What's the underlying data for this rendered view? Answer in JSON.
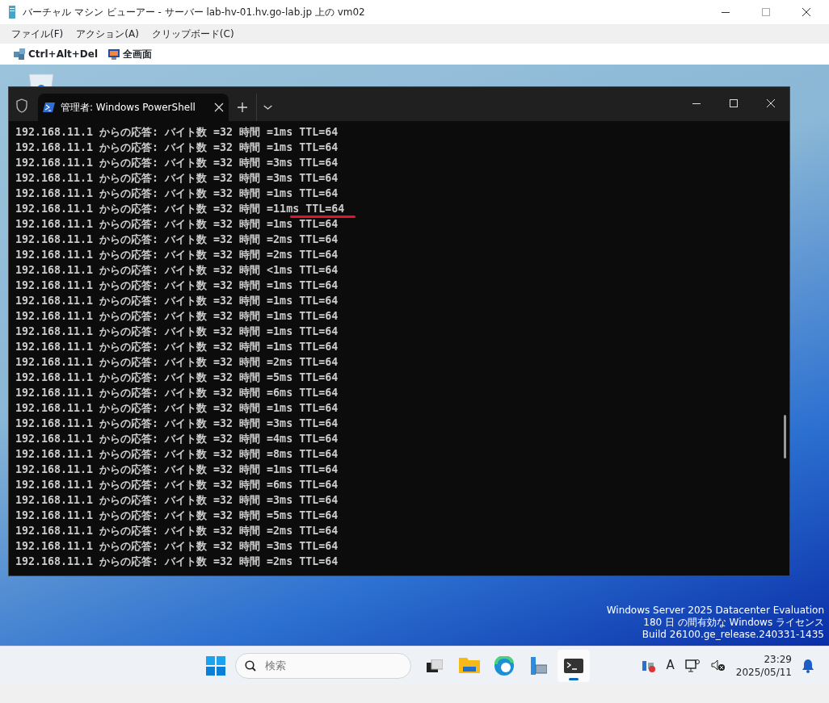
{
  "viewer": {
    "title": "バーチャル マシン ビューアー - サーバー lab-hv-01.hv.go-lab.jp 上の vm02",
    "menu": [
      "ファイル(F)",
      "アクション(A)",
      "クリップボード(C)"
    ],
    "toolbar": [
      {
        "kind": "keys",
        "label": "Ctrl+Alt+Del"
      },
      {
        "kind": "fullscreen",
        "label": "全画面"
      }
    ]
  },
  "terminal": {
    "tab": {
      "title": "管理者: Windows PowerShell",
      "selected": true
    },
    "lines": [
      {
        "text": "192.168.11.1 からの応答: バイト数 =32 時間 =1ms TTL=64",
        "highlighted": false
      },
      {
        "text": "192.168.11.1 からの応答: バイト数 =32 時間 =1ms TTL=64",
        "highlighted": false
      },
      {
        "text": "192.168.11.1 からの応答: バイト数 =32 時間 =3ms TTL=64",
        "highlighted": false
      },
      {
        "text": "192.168.11.1 からの応答: バイト数 =32 時間 =3ms TTL=64",
        "highlighted": false
      },
      {
        "text": "192.168.11.1 からの応答: バイト数 =32 時間 =1ms TTL=64",
        "highlighted": false
      },
      {
        "text": "192.168.11.1 からの応答: バイト数 =32 時間 =11ms TTL=64",
        "highlighted": true
      },
      {
        "text": "192.168.11.1 からの応答: バイト数 =32 時間 =1ms TTL=64",
        "highlighted": false
      },
      {
        "text": "192.168.11.1 からの応答: バイト数 =32 時間 =2ms TTL=64",
        "highlighted": false
      },
      {
        "text": "192.168.11.1 からの応答: バイト数 =32 時間 =2ms TTL=64",
        "highlighted": false
      },
      {
        "text": "192.168.11.1 からの応答: バイト数 =32 時間 <1ms TTL=64",
        "highlighted": false
      },
      {
        "text": "192.168.11.1 からの応答: バイト数 =32 時間 =1ms TTL=64",
        "highlighted": false
      },
      {
        "text": "192.168.11.1 からの応答: バイト数 =32 時間 =1ms TTL=64",
        "highlighted": false
      },
      {
        "text": "192.168.11.1 からの応答: バイト数 =32 時間 =1ms TTL=64",
        "highlighted": false
      },
      {
        "text": "192.168.11.1 からの応答: バイト数 =32 時間 =1ms TTL=64",
        "highlighted": false
      },
      {
        "text": "192.168.11.1 からの応答: バイト数 =32 時間 =1ms TTL=64",
        "highlighted": false
      },
      {
        "text": "192.168.11.1 からの応答: バイト数 =32 時間 =2ms TTL=64",
        "highlighted": false
      },
      {
        "text": "192.168.11.1 からの応答: バイト数 =32 時間 =5ms TTL=64",
        "highlighted": false
      },
      {
        "text": "192.168.11.1 からの応答: バイト数 =32 時間 =6ms TTL=64",
        "highlighted": false
      },
      {
        "text": "192.168.11.1 からの応答: バイト数 =32 時間 =1ms TTL=64",
        "highlighted": false
      },
      {
        "text": "192.168.11.1 からの応答: バイト数 =32 時間 =3ms TTL=64",
        "highlighted": false
      },
      {
        "text": "192.168.11.1 からの応答: バイト数 =32 時間 =4ms TTL=64",
        "highlighted": false
      },
      {
        "text": "192.168.11.1 からの応答: バイト数 =32 時間 =8ms TTL=64",
        "highlighted": false
      },
      {
        "text": "192.168.11.1 からの応答: バイト数 =32 時間 =1ms TTL=64",
        "highlighted": false
      },
      {
        "text": "192.168.11.1 からの応答: バイト数 =32 時間 =6ms TTL=64",
        "highlighted": false
      },
      {
        "text": "192.168.11.1 からの応答: バイト数 =32 時間 =3ms TTL=64",
        "highlighted": false
      },
      {
        "text": "192.168.11.1 からの応答: バイト数 =32 時間 =5ms TTL=64",
        "highlighted": false
      },
      {
        "text": "192.168.11.1 からの応答: バイト数 =32 時間 =2ms TTL=64",
        "highlighted": false
      },
      {
        "text": "192.168.11.1 からの応答: バイト数 =32 時間 =3ms TTL=64",
        "highlighted": false
      },
      {
        "text": "192.168.11.1 からの応答: バイト数 =32 時間 =2ms TTL=64",
        "highlighted": false
      }
    ]
  },
  "watermark_text": [
    "Windows Server 2025 Datacenter Evaluation",
    "180 日 の間有効な Windows ライセンス",
    "Build 26100.ge_release.240331-1435"
  ],
  "taskbar": {
    "search": {
      "placeholder": "検索"
    },
    "apps": [
      {
        "kind": "taskview",
        "active": false
      },
      {
        "kind": "explorer",
        "active": false
      },
      {
        "kind": "edge",
        "active": false
      },
      {
        "kind": "servermanager",
        "active": false
      },
      {
        "kind": "terminal",
        "active": true
      }
    ],
    "time": "23:29",
    "date": "2025/05/11",
    "ime": "A"
  }
}
